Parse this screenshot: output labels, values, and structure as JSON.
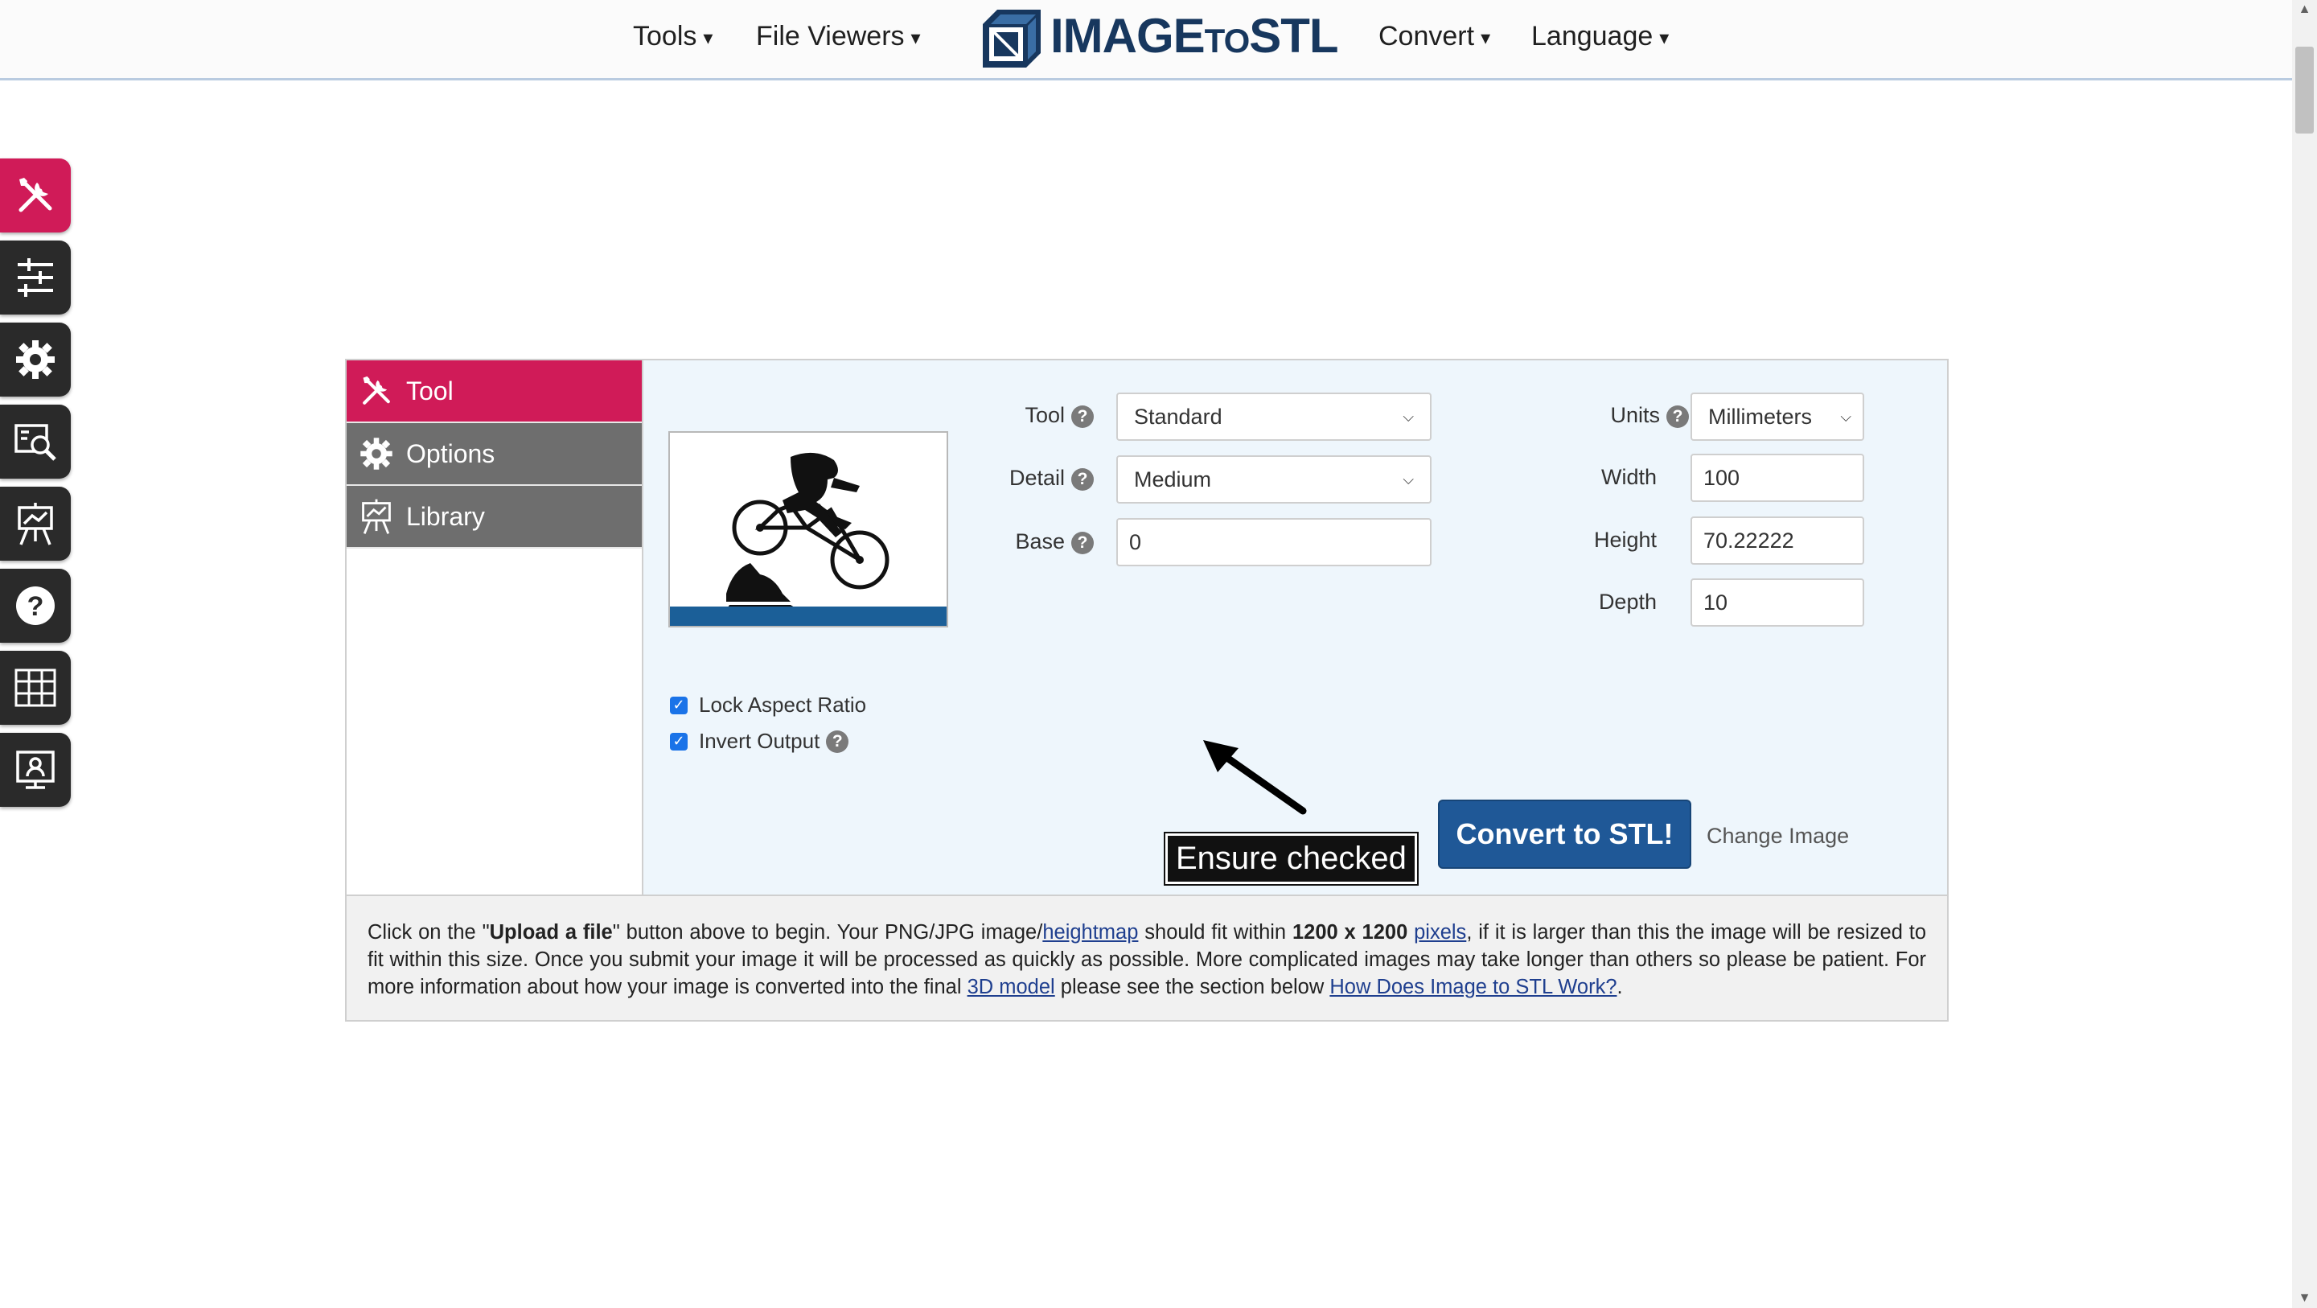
{
  "nav": {
    "left": [
      {
        "label": "Tools"
      },
      {
        "label": "File Viewers"
      }
    ],
    "right": [
      {
        "label": "Convert"
      },
      {
        "label": "Language"
      }
    ],
    "caret": "▾",
    "logo": {
      "main": "IMAGE",
      "small": "TO",
      "end": "STL"
    }
  },
  "sidebar": {
    "icons": [
      "tools-icon",
      "sliders-icon",
      "gear-icon",
      "image-search-icon",
      "easel-icon",
      "help-icon",
      "grid-icon",
      "user-monitor-icon"
    ],
    "active_color": "#d01b58"
  },
  "panel": {
    "tabs": [
      {
        "label": "Tool"
      },
      {
        "label": "Options"
      },
      {
        "label": "Library"
      }
    ],
    "fields": {
      "tool": {
        "label": "Tool",
        "value": "Standard"
      },
      "detail": {
        "label": "Detail",
        "value": "Medium"
      },
      "base": {
        "label": "Base",
        "value": "0"
      },
      "units": {
        "label": "Units",
        "value": "Millimeters"
      },
      "width": {
        "label": "Width",
        "value": "100"
      },
      "height": {
        "label": "Height",
        "value": "70.22222"
      },
      "depth": {
        "label": "Depth",
        "value": "10"
      }
    },
    "help_glyph": "?",
    "checkboxes": [
      {
        "label": "Lock Aspect Ratio",
        "checked": true
      },
      {
        "label": "Invert Output",
        "checked": true
      }
    ],
    "check_glyph": "✓",
    "convert_label": "Convert to STL!",
    "change_image_label": "Change Image",
    "annotation": "Ensure checked"
  },
  "info": {
    "t1": "Click on the \"",
    "b1": "Upload a file",
    "t2": "\" button above to begin. Your PNG/JPG image/",
    "l1": "heightmap",
    "t3": " should fit within ",
    "b2": "1200 x 1200",
    "t4": " ",
    "l2": "pixels",
    "t5": ", if it is larger than this the image will be resized to fit within this size. Once you submit your image it will be processed as quickly as possible. More complicated images may take longer than others so please be patient. For more information about how your image is converted into the final ",
    "l3": "3D model",
    "t6": " please see the section below ",
    "l4": "How Does Image to STL Work?",
    "t7": "."
  },
  "colors": {
    "brand_pink": "#d01b58",
    "brand_blue": "#1f5897",
    "tab_gray": "#6e6e6e",
    "content_bg": "#eef6fc"
  }
}
